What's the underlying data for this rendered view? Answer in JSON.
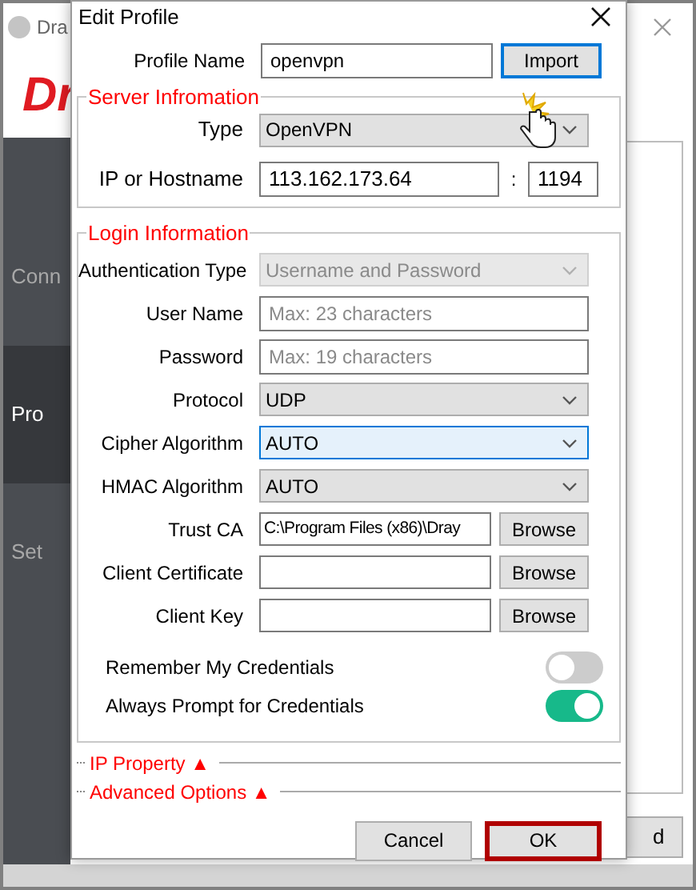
{
  "app": {
    "title": "Dra",
    "logo": "Dr",
    "sidebar": [
      {
        "label": "Conn",
        "selected": false
      },
      {
        "label": "Pro",
        "selected": true
      },
      {
        "label": "Set",
        "selected": false
      }
    ],
    "button": "d"
  },
  "dialog": {
    "title": "Edit Profile",
    "profile_name": {
      "label": "Profile Name",
      "value": "openvpn"
    },
    "import_button": "Import",
    "server_section": {
      "title": "Server Infromation",
      "type": {
        "label": "Type",
        "value": "OpenVPN"
      },
      "host": {
        "label": "IP or Hostname",
        "value": "113.162.173.64",
        "separator": ":",
        "port": "1194"
      }
    },
    "login_section": {
      "title": "Login Information",
      "fields": [
        {
          "kind": "select",
          "label": "Authentication Type",
          "value": "Username and Password",
          "disabled": true,
          "focused": false
        },
        {
          "kind": "input",
          "label": "User Name",
          "placeholder": "Max: 23 characters"
        },
        {
          "kind": "input",
          "label": "Password",
          "placeholder": "Max: 19 characters"
        },
        {
          "kind": "select",
          "label": "Protocol",
          "value": "UDP",
          "disabled": false,
          "focused": false
        },
        {
          "kind": "select",
          "label": "Cipher Algorithm",
          "value": "AUTO",
          "disabled": false,
          "focused": true
        },
        {
          "kind": "select",
          "label": "HMAC Algorithm",
          "value": "AUTO",
          "disabled": false,
          "focused": false
        },
        {
          "kind": "file",
          "label": "Trust CA",
          "value": "C:\\Program Files (x86)\\Dray",
          "button": "Browse"
        },
        {
          "kind": "file",
          "label": "Client Certificate",
          "button": "Browse"
        },
        {
          "kind": "file",
          "label": "Client Key",
          "button": "Browse"
        }
      ],
      "toggles": [
        {
          "label": "Remember My Credentials",
          "on": false
        },
        {
          "label": "Always Prompt for Credentials",
          "on": true
        }
      ]
    },
    "sections": [
      {
        "label": "IP Property",
        "arrow": "▲"
      },
      {
        "label": "Advanced Options",
        "arrow": "▲"
      }
    ],
    "buttons": [
      {
        "label": "Cancel",
        "default": false
      },
      {
        "label": "OK",
        "default": true
      }
    ]
  }
}
